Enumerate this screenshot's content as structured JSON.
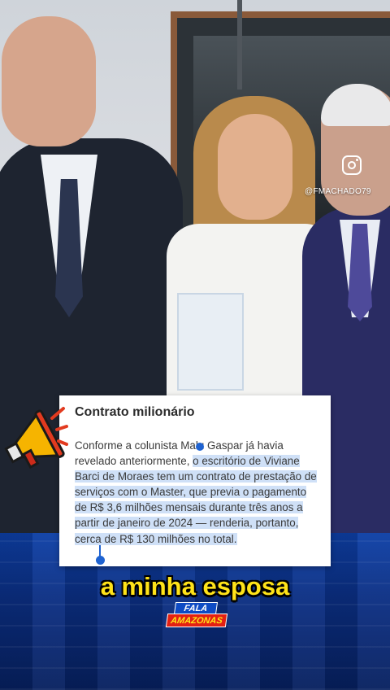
{
  "watermark": {
    "icon": "instagram-icon",
    "handle": "@FMACHADO79"
  },
  "article": {
    "title": "Contrato milionário",
    "body_plain": "Conforme a colunista Malu Gaspar já havia revelado anteriormente, ",
    "body_highlight": "o escritório de Viviane Barci de Moraes tem um contrato de prestação de serviços com o Master, que previa o pagamento de R$ 3,6 milhões mensais durante três anos a partir de janeiro de 2024 — renderia, portanto, cerca de R$ 130 milhões no total."
  },
  "subtitle": "a minha esposa",
  "logo": {
    "top": "FALA",
    "bottom": "AMAZONAS"
  },
  "colors": {
    "subtitle": "#ffe319",
    "selection_handle": "#1f63d1",
    "selection_highlight": "#cfe0f7",
    "panel_blue": "#0d3fa6",
    "logo_red": "#e32012"
  }
}
